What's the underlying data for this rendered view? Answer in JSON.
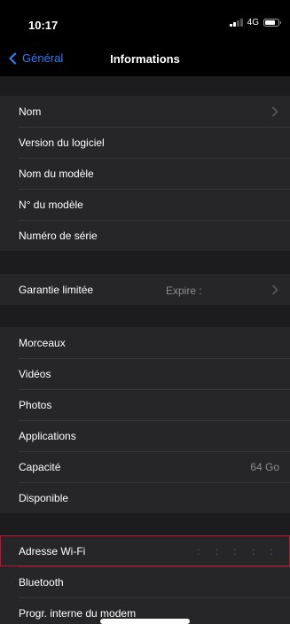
{
  "status": {
    "time": "10:17",
    "network": "4G",
    "signal_bars": 2,
    "battery_level": 0.8
  },
  "nav": {
    "back_label": "Général",
    "title": "Informations"
  },
  "groups": [
    {
      "rows": [
        {
          "label": "Nom",
          "value": "",
          "chevron": true
        },
        {
          "label": "Version du logiciel",
          "value": ""
        },
        {
          "label": "Nom du modèle",
          "value": ""
        },
        {
          "label": "N° du modèle",
          "value": ""
        },
        {
          "label": "Numéro de série",
          "value": ""
        }
      ]
    },
    {
      "rows": [
        {
          "label": "Garantie limitée",
          "value": "Expire :",
          "chevron": true
        }
      ]
    },
    {
      "rows": [
        {
          "label": "Morceaux",
          "value": ""
        },
        {
          "label": "Vidéos",
          "value": ""
        },
        {
          "label": "Photos",
          "value": ""
        },
        {
          "label": "Applications",
          "value": ""
        },
        {
          "label": "Capacité",
          "value": "64 Go"
        },
        {
          "label": "Disponible",
          "value": ""
        }
      ]
    },
    {
      "rows": [
        {
          "label": "Adresse Wi-Fi",
          "value": ": : : : :",
          "highlighted": true
        },
        {
          "label": "Bluetooth",
          "value": ""
        },
        {
          "label": "Progr. interne du modem",
          "value": ""
        }
      ]
    }
  ],
  "colors": {
    "accent": "#2d7ef7",
    "highlight_border": "#c8102e",
    "group_background": "#262629",
    "gap_background": "#1c1c1e"
  }
}
